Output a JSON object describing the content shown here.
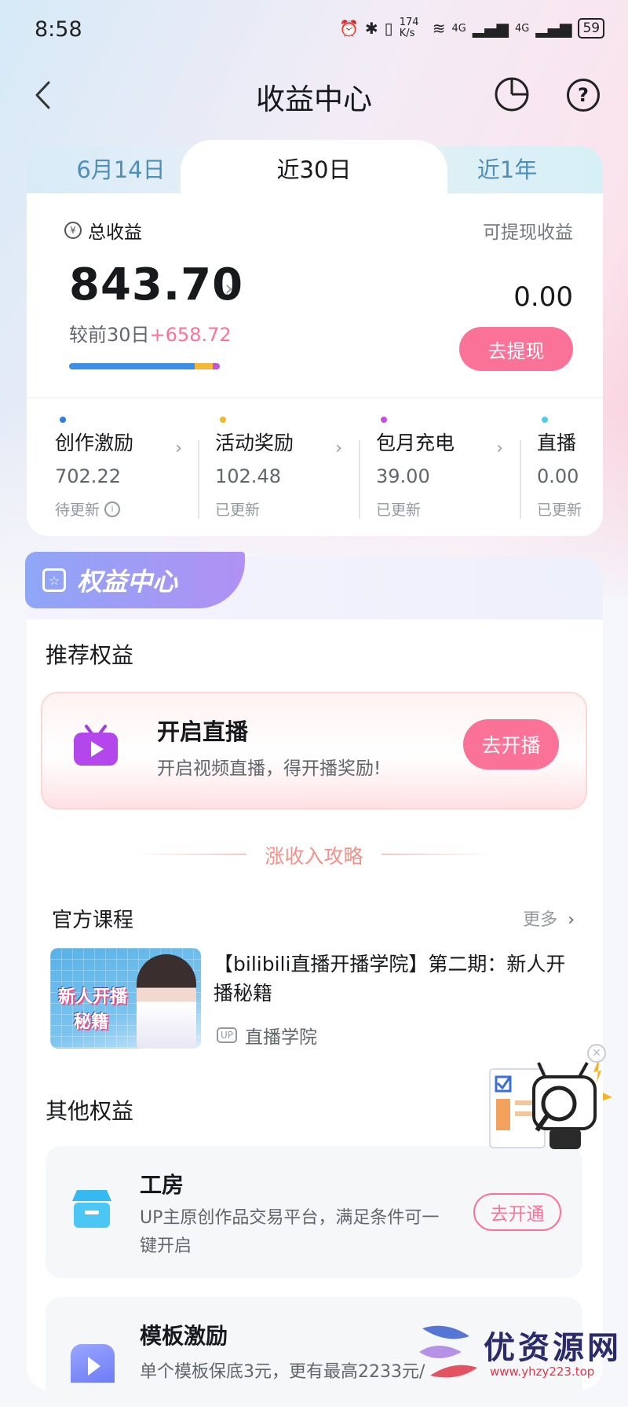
{
  "status_bar": {
    "time": "8:58",
    "network_speed": "174 K/s",
    "signal_1": "4G",
    "signal_2": "4G",
    "battery": "59"
  },
  "nav": {
    "title": "收益中心"
  },
  "tabs": [
    {
      "label": "6月14日",
      "active": false
    },
    {
      "label": "近30日",
      "active": true
    },
    {
      "label": "近1年",
      "active": false
    }
  ],
  "earnings": {
    "total_label": "总收益",
    "total_amount": "843.70",
    "compare_prefix": "较前30日",
    "compare_delta": "+658.72",
    "withdrawable_label": "可提现收益",
    "withdrawable_amount": "0.00",
    "withdraw_button": "去提现",
    "progress_segments": [
      {
        "fraction": 0.832,
        "color": "#3b8fe4"
      },
      {
        "fraction": 0.121,
        "color": "#f4b836"
      },
      {
        "fraction": 0.047,
        "color": "#c552dd"
      }
    ]
  },
  "categories": [
    {
      "name": "创作激励",
      "value": "702.22",
      "status": "待更新",
      "dot_color": "#2f7fd9",
      "has_info": true
    },
    {
      "name": "活动奖励",
      "value": "102.48",
      "status": "已更新",
      "dot_color": "#f0b92c",
      "has_info": false
    },
    {
      "name": "包月充电",
      "value": "39.00",
      "status": "已更新",
      "dot_color": "#c84ee0",
      "has_info": false
    },
    {
      "name": "直播",
      "value": "0.00",
      "status": "已更新",
      "dot_color": "#4fcfe6",
      "has_info": false
    }
  ],
  "benefits": {
    "header": "权益中心",
    "recommended_title": "推荐权益",
    "live": {
      "title": "开启直播",
      "desc": "开启视频直播，得开播奖励!",
      "button": "去开播"
    },
    "tips_title": "涨收入攻略",
    "courses": {
      "title": "官方课程",
      "more": "更多",
      "item": {
        "thumb_line1": "新人开播",
        "thumb_line2": "秘籍",
        "title": "【bilibili直播开播学院】第二期：新人开播秘籍",
        "author_badge": "UP",
        "author": "直播学院"
      }
    },
    "other_title": "其他权益",
    "workshop": {
      "title": "工房",
      "desc": "UP主原创作品交易平台，满足条件可一键开启",
      "button": "去开通"
    },
    "template": {
      "title": "模板激励",
      "desc": "单个模板保底3元，更有最高2233元/"
    }
  },
  "watermark": {
    "text": "优资源网",
    "url": "www.yhzy223.top"
  }
}
